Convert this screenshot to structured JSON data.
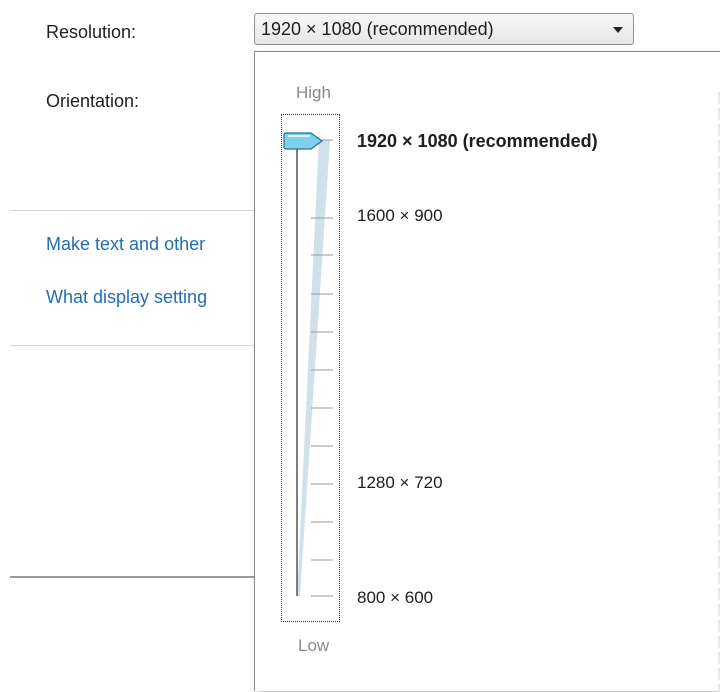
{
  "settings": {
    "resolution_label": "Resolution:",
    "orientation_label": "Orientation:",
    "resolution_value": "1920 × 1080 (recommended)",
    "link_text_size": "Make text and other",
    "link_display_settings": "What display setting"
  },
  "slider": {
    "high_label": "High",
    "low_label": "Low",
    "options": [
      "1920 × 1080 (recommended)",
      "1600 × 900",
      "1280 × 720",
      "800 × 600"
    ],
    "selected_index": 0,
    "thumb_color": "#7fd0ea"
  }
}
